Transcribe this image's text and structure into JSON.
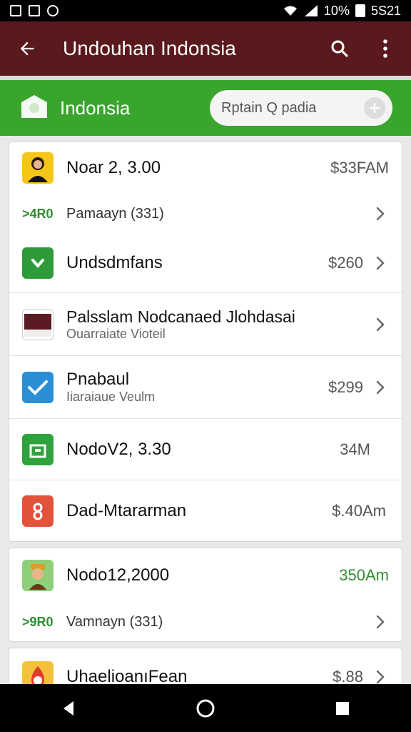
{
  "status": {
    "battery": "10%",
    "time": "5S21"
  },
  "appbar": {
    "title": "Undouhan Indonsia"
  },
  "header": {
    "title": "Indonsia",
    "search_placeholder": "Rptain Q padia"
  },
  "items": [
    {
      "title": "Noar 2, 3.00",
      "right": "$33FAM",
      "tag": ">4R0",
      "sub": "Pamaayn (331)"
    },
    {
      "title": "Undsdmfans",
      "right": "$260"
    },
    {
      "title": "Palsslam Nodcanaed Jlohdasai",
      "sub": "Ouarraiate Vioteil"
    },
    {
      "title": "Pnabaul",
      "sub": "Iiaraiaue Veulm",
      "right": "$299"
    },
    {
      "title": "NodoV2, 3.30",
      "right": "34M"
    },
    {
      "title": "Dad-Mtararman",
      "right": "$.40Am"
    },
    {
      "title": "Nodo12,2000",
      "right": "350Am",
      "tag": ">9R0",
      "sub": "Vamnayn (331)"
    },
    {
      "title": "UhaelioanıFean",
      "right": "$.88"
    }
  ],
  "colors": {
    "appbar": "#5a1a1d",
    "greenbar": "#3aa52d",
    "accent_green": "#2f8f2f"
  },
  "icons": [
    "image-icon",
    "notification-icon",
    "cat-icon",
    "wifi-icon",
    "signal-icon",
    "battery-icon",
    "back-arrow-icon",
    "search-icon",
    "more-vert-icon",
    "chat-bubble-icon",
    "plus-icon",
    "chevron-right-icon",
    "nav-back-icon",
    "nav-home-icon",
    "nav-recents-icon"
  ]
}
